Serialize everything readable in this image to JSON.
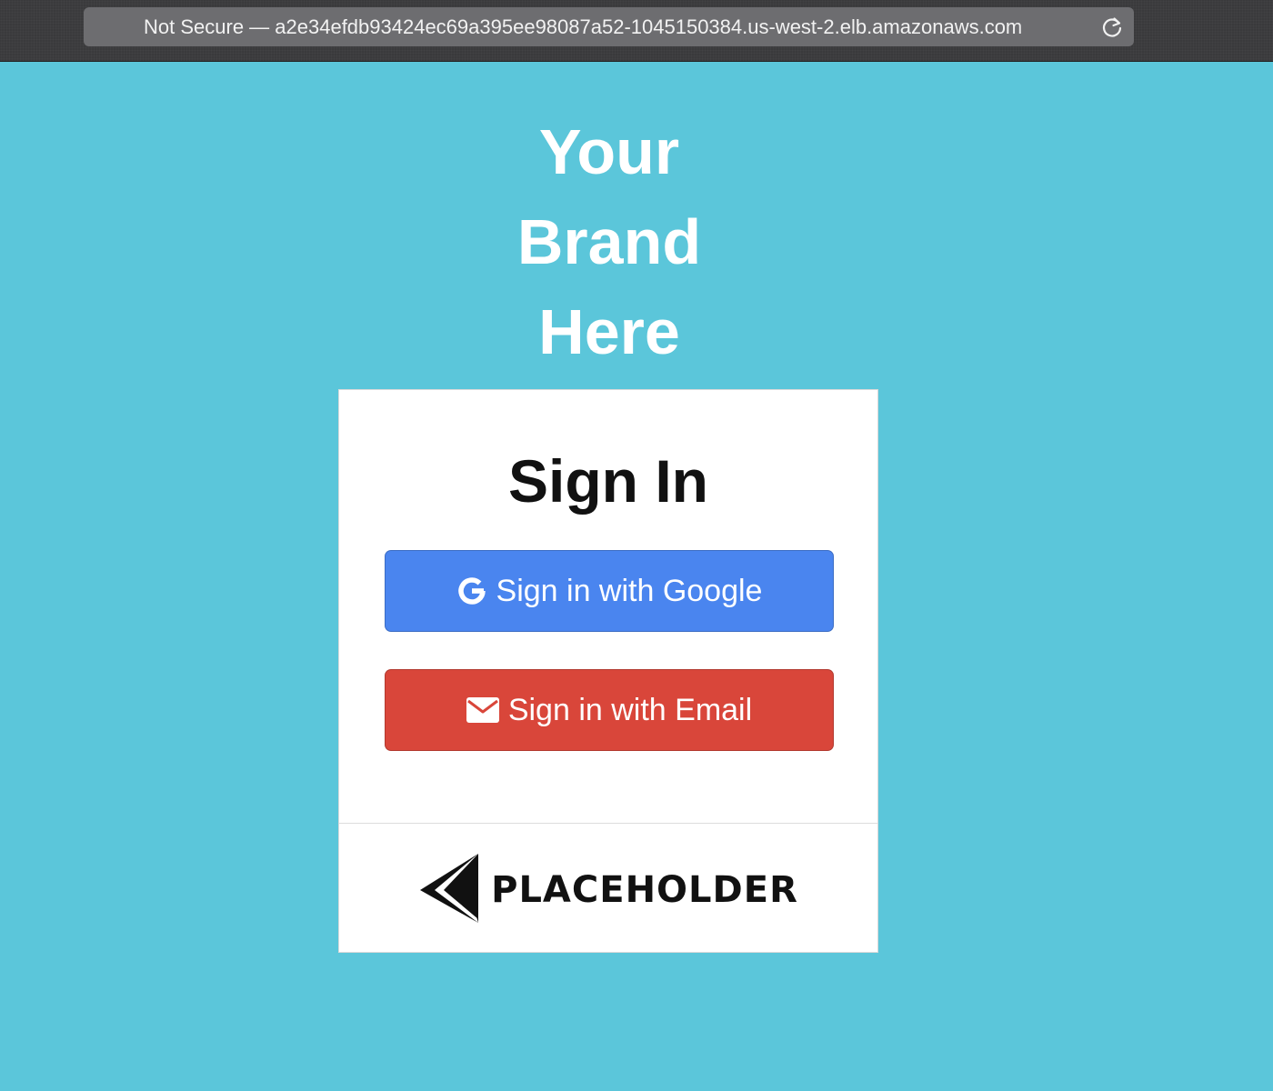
{
  "browser": {
    "address": "Not Secure — a2e34efdb93424ec69a395ee98087a52-1045150384.us-west-2.elb.amazonaws.com",
    "reload_icon": "reload-icon"
  },
  "brand": {
    "line1": "Your",
    "line2": "Brand",
    "line3": "Here",
    "color": "#ffffff"
  },
  "page": {
    "background_color": "#5bc6da"
  },
  "card": {
    "title": "Sign In",
    "google_button": {
      "label": "Sign in with Google",
      "icon": "google-icon",
      "color": "#4a85ef"
    },
    "email_button": {
      "label": "Sign in with Email",
      "icon": "envelope-icon",
      "color": "#d9463a"
    },
    "footer_logo_text": "PLACEHOLDER"
  }
}
